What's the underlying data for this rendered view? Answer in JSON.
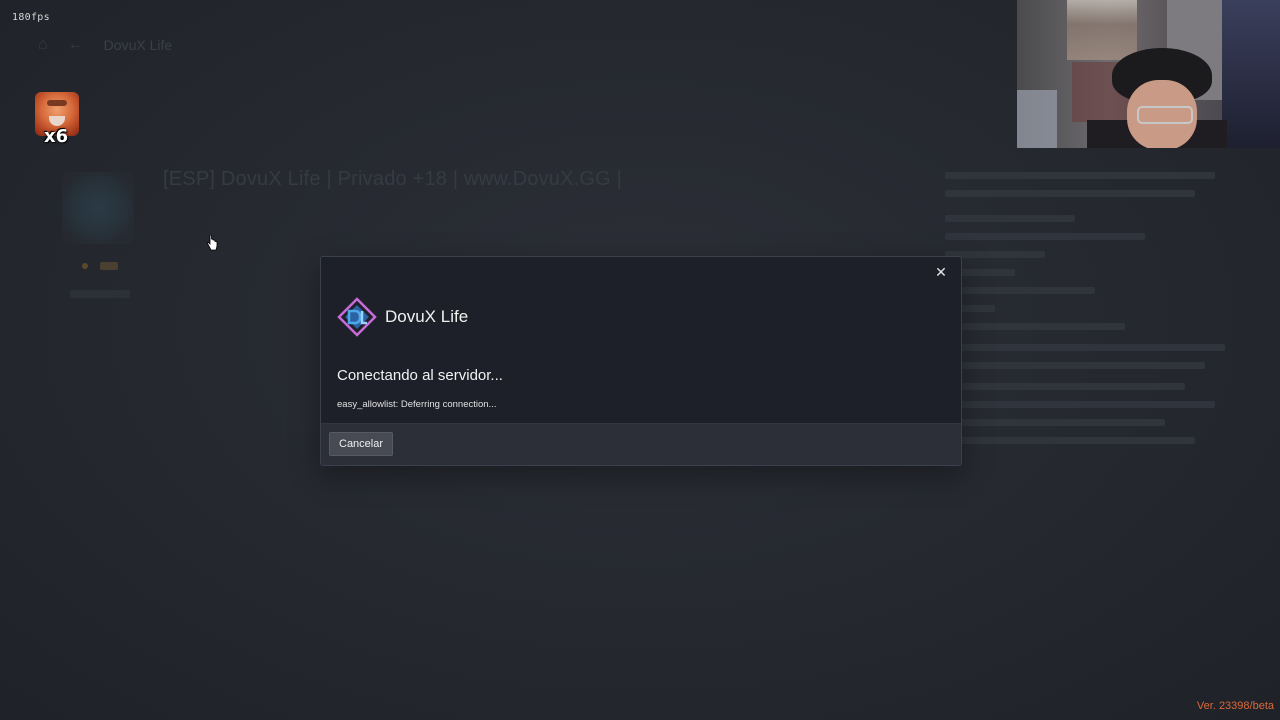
{
  "overlay": {
    "fps": "180fps",
    "emote_multiplier": "x6",
    "version": "Ver. 23398/beta"
  },
  "background": {
    "breadcrumb": "DovuX Life",
    "server_title": "[ESP] DovuX Life | Privado +18 | www.DovuX.GG |"
  },
  "modal": {
    "brand_name": "DovuX Life",
    "status_title": "Conectando al servidor...",
    "status_detail": "easy_allowlist: Deferring connection...",
    "cancel_label": "Cancelar",
    "close_glyph": "✕"
  },
  "colors": {
    "version_text": "#d96a3a",
    "modal_bg": "#1d2029",
    "footer_bg": "#2c2f37",
    "logo_blue": "#4aa8e8",
    "logo_pink": "#c86ad8"
  },
  "icons": {
    "home": "home-icon",
    "back": "back-arrow-icon",
    "close": "close-icon",
    "cursor": "hand-cursor-icon",
    "brand": "dovux-logo-icon"
  }
}
